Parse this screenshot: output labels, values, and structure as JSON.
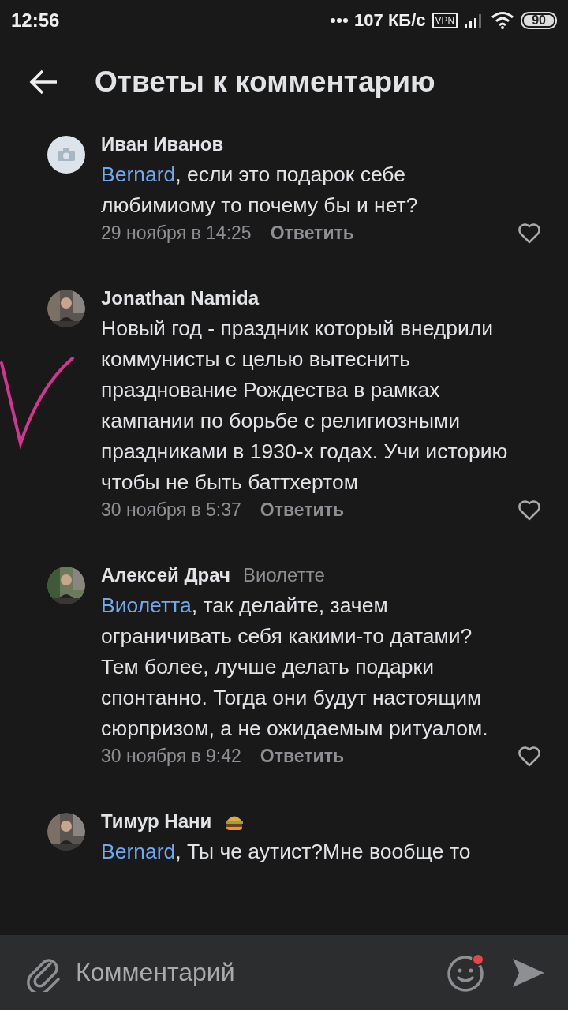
{
  "status_bar": {
    "time": "12:56",
    "speed": "107 КБ/с",
    "vpn": "VPN",
    "battery": "90"
  },
  "header": {
    "title": "Ответы к комментарию"
  },
  "comments": [
    {
      "author": "Иван Иванов",
      "kind": "placeholder",
      "badge": false,
      "mention": "Bernard",
      "text": ", если это подарок себе любимиому то почему бы и нет?",
      "date": "29 ноября в 14:25",
      "reply_label": "Ответить",
      "liked": false
    },
    {
      "author": "Jonathan Namida",
      "kind": "picture",
      "badge": false,
      "text": "Новый год - праздник который внедрили коммунисты с целью вытеснить празднование Рождества в рамках кампании по борьбе с религиозными праздниками в 1930-х годах. Учи историю чтобы не быть баттхертом",
      "date": "30 ноября в 5:37",
      "reply_label": "Ответить",
      "liked": false
    },
    {
      "author": "Алексей Драч",
      "reply_to": "Виолетте",
      "kind": "picture",
      "badge": false,
      "mention": "Виолетта",
      "text": ", так делайте, зачем ограничивать себя какими-то датами? Тем более, лучше делать подарки спонтанно. Тогда они будут настоящим сюрпризом, а не ожидаемым ритуалом.",
      "date": "30 ноября в 9:42",
      "reply_label": "Ответить",
      "liked": false
    },
    {
      "author": "Тимур Нани",
      "kind": "picture",
      "badge": true,
      "mention": "Bernard",
      "text": ", Ты че аутист?Мне вообще то"
    }
  ],
  "composer": {
    "placeholder": "Комментарий",
    "emoji_notification": true
  }
}
